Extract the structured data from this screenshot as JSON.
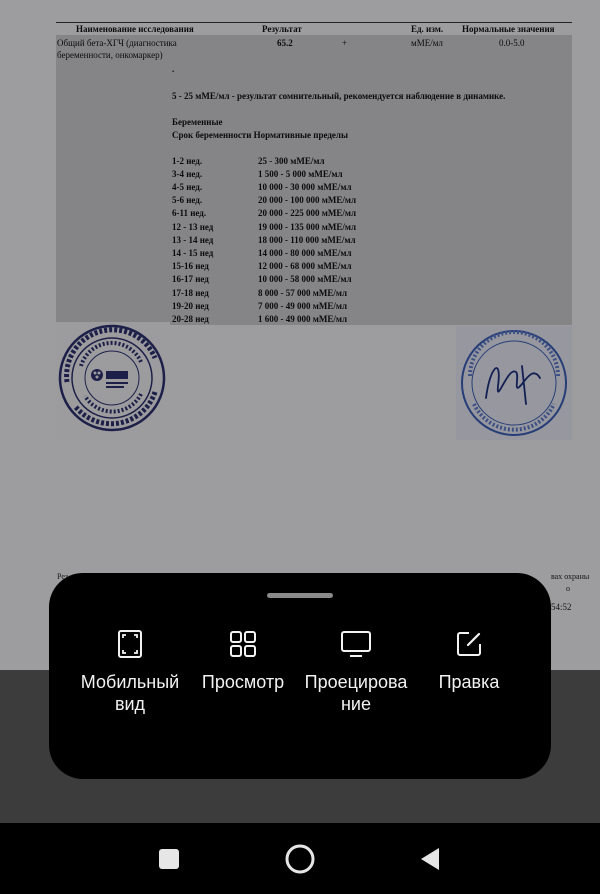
{
  "document": {
    "table_header": {
      "name": "Наименование исследования",
      "result": "Результат",
      "unit": "Ед. изм.",
      "normal": "Нормальные значения"
    },
    "row": {
      "name_line1": "Общий бета-ХГЧ (диагностика",
      "name_line2": "беременности, онкомаркер)",
      "value": "65.2",
      "flag": "+",
      "unit": "мМЕ/мл",
      "normal": "0.0-5.0"
    },
    "dot": ".",
    "note": "5 - 25 мМЕ/мл - результат сомнительный, рекомендуется наблюдение в динамике.",
    "pregnant_title": "Беременные",
    "pregnant_subtitle": "Срок беременности  Нормативные пределы",
    "ref_rows": [
      {
        "term": "1-2 нед.",
        "range": "25 - 300 мМЕ/мл"
      },
      {
        "term": "3-4 нед.",
        "range": "1 500 - 5 000 мМЕ/мл"
      },
      {
        "term": "4-5 нед.",
        "range": "10 000 - 30 000 мМЕ/мл"
      },
      {
        "term": "5-6 нед.",
        "range": "20 000 - 100 000 мМЕ/мл"
      },
      {
        "term": "6-11 нед.",
        "range": "20 000 - 225 000 мМЕ/мл"
      },
      {
        "term": "12 - 13 нед",
        "range": "19 000 - 135 000 мМЕ/мл"
      },
      {
        "term": "13 - 14 нед",
        "range": "18 000 - 110 000 мМЕ/мл"
      },
      {
        "term": "14 - 15 нед",
        "range": "14 000 - 80 000 мМЕ/мл"
      },
      {
        "term": "15-16 нед",
        "range": "12 000 - 68 000 мМЕ/мл"
      },
      {
        "term": "16-17 нед",
        "range": "10 000 - 58 000 мМЕ/мл"
      },
      {
        "term": "17-18 нед",
        "range": "8 000 - 57 000 мМЕ/мл"
      },
      {
        "term": "19-20 нед",
        "range": "7 000 - 49 000 мМЕ/мл"
      },
      {
        "term": "20-28 нед",
        "range": "1 600 - 49 000 мМЕ/мл"
      }
    ],
    "stamp_left": {
      "outer_text": "ДЛЯ МЕДИЦИНСКИХ ИССЛЕДОВАНИЙ • ИНН 5009046778 • ООО \"ЦКЛ ДОМОДЕДОВО-ТЕСТ\"",
      "inner_text": "Московская область • Город Домодедово",
      "logo": "KDL"
    },
    "stamp_right": {
      "bottom_text": "Уманова Юлия Дмитриевна"
    },
    "footer_left": "Рез",
    "footer_right1": "вах охраны",
    "footer_right2": "о",
    "footer_time": "54:52"
  },
  "sheet": {
    "actions": [
      {
        "icon": "mobile-view-icon",
        "label_line1": "Мобильный",
        "label_line2": "вид"
      },
      {
        "icon": "grid-view-icon",
        "label_line1": "Просмотр",
        "label_line2": ""
      },
      {
        "icon": "monitor-icon",
        "label_line1": "Проецирова",
        "label_line2": "ние"
      },
      {
        "icon": "edit-icon",
        "label_line1": "Правка",
        "label_line2": ""
      }
    ]
  },
  "navbar": {
    "recents": "recents-icon",
    "home": "home-icon",
    "back": "back-icon"
  },
  "colors": {
    "sheet_bg": "#000000",
    "lower_bg": "#3c3c3c",
    "stamp_left": "#2c2f6b",
    "stamp_right": "#3a5bb0"
  }
}
